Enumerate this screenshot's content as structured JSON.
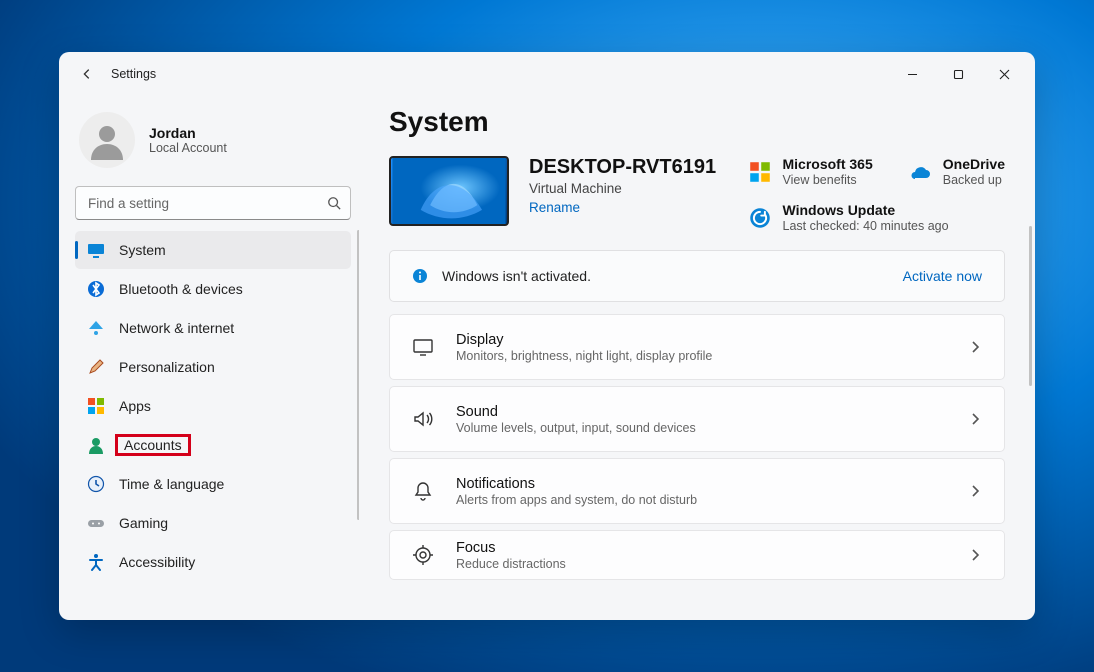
{
  "titlebar": {
    "title": "Settings"
  },
  "profile": {
    "name": "Jordan",
    "sub": "Local Account"
  },
  "search": {
    "placeholder": "Find a setting"
  },
  "nav": {
    "items": [
      {
        "label": "System"
      },
      {
        "label": "Bluetooth & devices"
      },
      {
        "label": "Network & internet"
      },
      {
        "label": "Personalization"
      },
      {
        "label": "Apps"
      },
      {
        "label": "Accounts"
      },
      {
        "label": "Time & language"
      },
      {
        "label": "Gaming"
      },
      {
        "label": "Accessibility"
      }
    ]
  },
  "main": {
    "heading": "System",
    "device": {
      "name": "DESKTOP-RVT6191",
      "type": "Virtual Machine",
      "rename": "Rename"
    },
    "tiles": {
      "m365": {
        "title": "Microsoft 365",
        "sub": "View benefits"
      },
      "onedrive": {
        "title": "OneDrive",
        "sub": "Backed up"
      },
      "update": {
        "title": "Windows Update",
        "sub": "Last checked: 40 minutes ago"
      }
    },
    "banner": {
      "text": "Windows isn't activated.",
      "link": "Activate now"
    },
    "rows": [
      {
        "title": "Display",
        "sub": "Monitors, brightness, night light, display profile"
      },
      {
        "title": "Sound",
        "sub": "Volume levels, output, input, sound devices"
      },
      {
        "title": "Notifications",
        "sub": "Alerts from apps and system, do not disturb"
      },
      {
        "title": "Focus",
        "sub": "Reduce distractions"
      }
    ]
  }
}
